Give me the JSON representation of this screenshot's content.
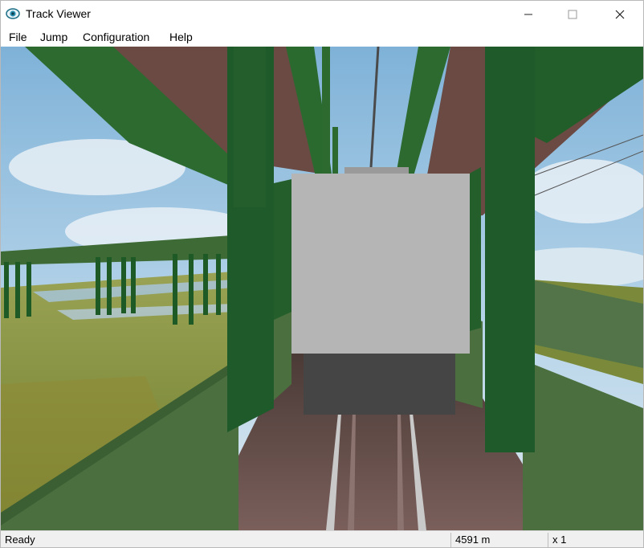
{
  "window": {
    "title": "Track Viewer"
  },
  "icons": {
    "app": "track-viewer-eye-icon",
    "minimize": "minimize-icon",
    "maximize": "maximize-icon",
    "close": "close-icon"
  },
  "menu": {
    "items": [
      "File",
      "Jump",
      "Configuration",
      "Help"
    ]
  },
  "status": {
    "state": "Ready",
    "distance": "4591 m",
    "speed_multiplier": "x 1"
  },
  "colors": {
    "steel_green": "#1f5a2a",
    "sky": "#9fc7e3",
    "grass": "#8a9a3e",
    "train_body": "#b5b5b5",
    "train_lower": "#454545"
  }
}
